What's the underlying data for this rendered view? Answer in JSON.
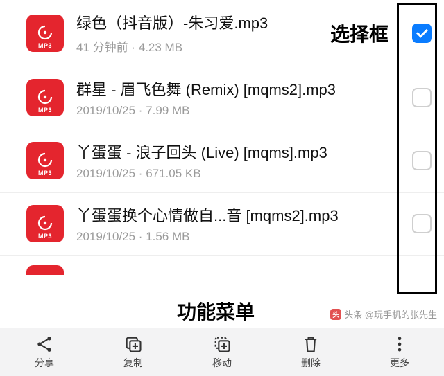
{
  "icon_format": "MP3",
  "files": [
    {
      "title": "绿色（抖音版）-朱习爱.mp3",
      "meta": "41 分钟前 · 4.23 MB",
      "checked": true
    },
    {
      "title": "群星 - 眉飞色舞 (Remix) [mqms2].mp3",
      "meta": "2019/10/25 · 7.99 MB",
      "checked": false
    },
    {
      "title": "丫蛋蛋 - 浪子回头 (Live) [mqms].mp3",
      "meta": "2019/10/25 · 671.05 KB",
      "checked": false
    },
    {
      "title": "丫蛋蛋换个心情做自...音 [mqms2].mp3",
      "meta": "2019/10/25 · 1.56 MB",
      "checked": false
    }
  ],
  "annotations": {
    "select_label": "选择框",
    "menu_label": "功能菜单"
  },
  "toolbar": {
    "share": "分享",
    "copy": "复制",
    "move": "移动",
    "delete": "删除",
    "more": "更多"
  },
  "watermark": "头条 @玩手机的张先生"
}
